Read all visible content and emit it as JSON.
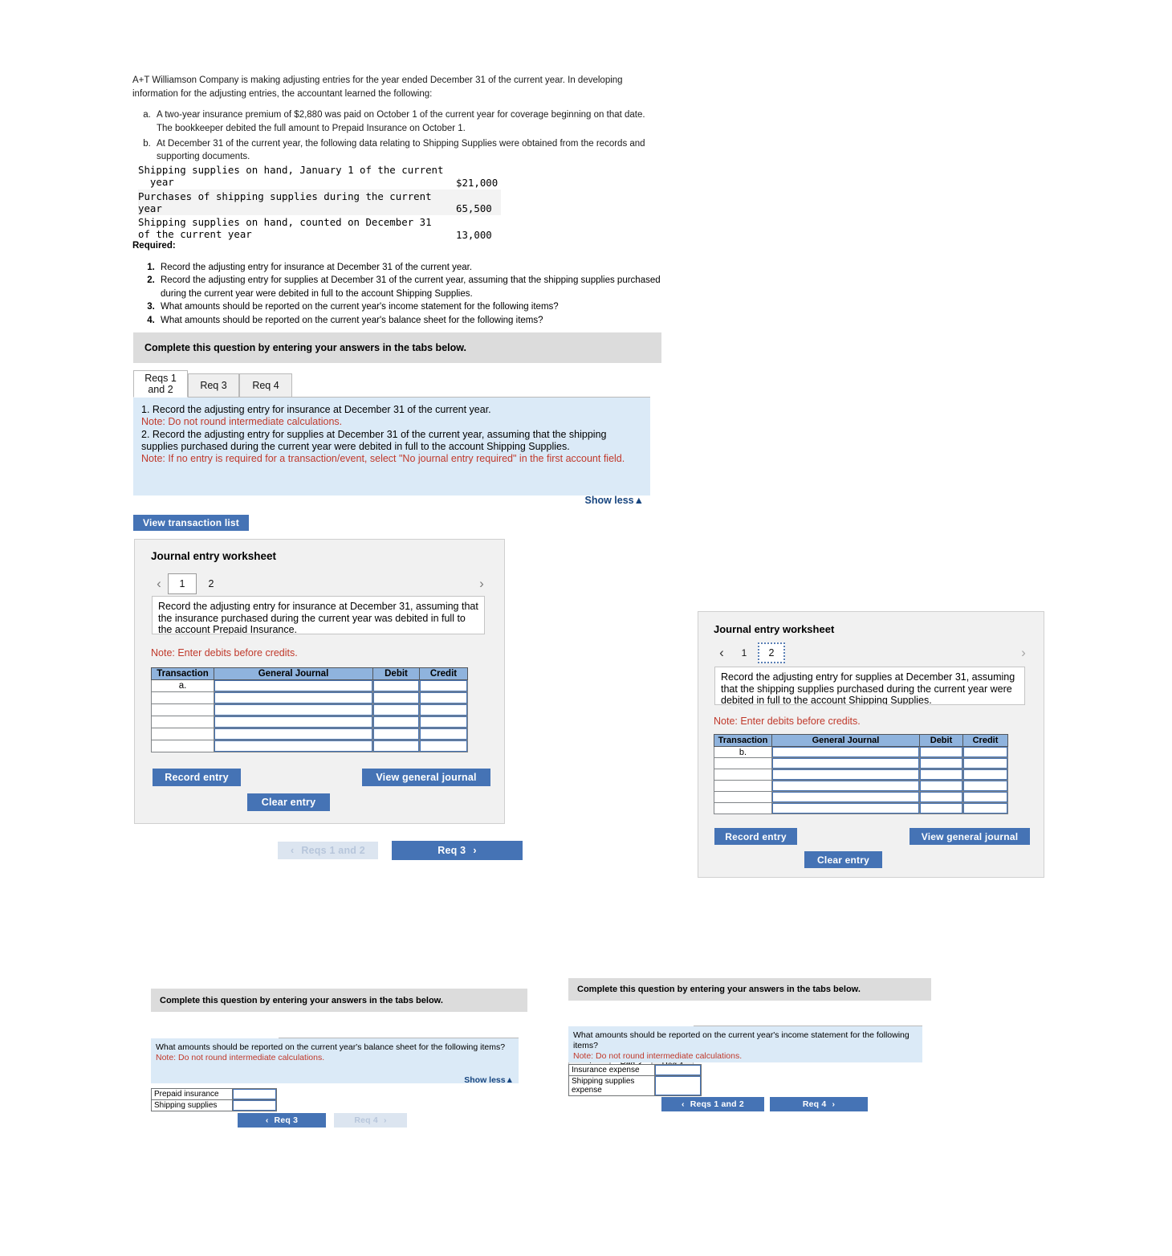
{
  "problem": {
    "intro": "A+T Williamson Company is making adjusting entries for the year ended December 31 of the current year. In developing information for the adjusting entries, the accountant learned the following:",
    "items": [
      "A two-year insurance premium of $2,880 was paid on October 1 of the current year for coverage beginning on that date. The bookkeeper debited the full amount to Prepaid Insurance on October 1.",
      "At December 31 of the current year, the following data relating to Shipping Supplies were obtained from the records and supporting documents."
    ],
    "supplies_table": {
      "rows": [
        {
          "label": "Shipping supplies on hand, January 1 of the current\n  year",
          "value": "$21,000"
        },
        {
          "label": "Purchases of shipping supplies during the current\nyear",
          "value": "65,500"
        },
        {
          "label": "Shipping supplies on hand, counted on December 31\nof the current year",
          "value": "13,000"
        }
      ]
    },
    "required_heading": "Required:",
    "required_items": [
      "Record the adjusting entry for insurance at December 31 of the current year.",
      "Record the adjusting entry for supplies at December 31 of the current year, assuming that the shipping supplies purchased during the current year were debited in full to the account Shipping Supplies.",
      "What amounts should be reported on the current year's income statement for the following items?",
      "What amounts should be reported on the current year's balance sheet for the following items?"
    ]
  },
  "common": {
    "complete_bar": "Complete this question by entering your answers in the tabs below.",
    "tabs": [
      "Reqs 1 and 2",
      "Req 3",
      "Req 4"
    ],
    "tab_lines": [
      [
        "Reqs 1",
        "and 2"
      ],
      [
        "Req 3"
      ],
      [
        "Req 4"
      ]
    ],
    "show_less": "Show less",
    "show_less_caret": "▲",
    "prev_arrow": "‹",
    "next_arrow": "›",
    "accent_blue": "#4573b5",
    "panel_blue": "#dbeaf7",
    "note_red": "#c0392b"
  },
  "panel_reqs12": {
    "instruction_line1": "1. Record the adjusting entry for insurance at December 31 of the current year.",
    "note1": "Note: Do not round intermediate calculations.",
    "instruction_line2": "2. Record the adjusting entry for supplies at December 31 of the current year, assuming that the shipping supplies purchased during the current year were debited in full to the account Shipping Supplies.",
    "note2": "Note: If no entry is required for a transaction/event, select \"No journal entry required\" in the first account field.",
    "view_transaction_list": "View transaction list",
    "worksheet": {
      "title": "Journal entry worksheet",
      "pages": [
        "1",
        "2"
      ],
      "active_page": "1",
      "prompt": "Record the adjusting entry for insurance at December 31, assuming that the insurance purchased during the current year was debited in full to the account Prepaid Insurance.",
      "note": "Note: Enter debits before credits.",
      "columns": [
        "Transaction",
        "General Journal",
        "Debit",
        "Credit"
      ],
      "rows": [
        {
          "txn": "a.",
          "general_journal": "",
          "debit": "",
          "credit": ""
        },
        {
          "txn": "",
          "general_journal": "",
          "debit": "",
          "credit": ""
        },
        {
          "txn": "",
          "general_journal": "",
          "debit": "",
          "credit": ""
        },
        {
          "txn": "",
          "general_journal": "",
          "debit": "",
          "credit": ""
        },
        {
          "txn": "",
          "general_journal": "",
          "debit": "",
          "credit": ""
        },
        {
          "txn": "",
          "general_journal": "",
          "debit": "",
          "credit": ""
        }
      ],
      "record_entry": "Record entry",
      "clear_entry": "Clear entry",
      "view_general_journal": "View general journal"
    },
    "nav_prev": "Reqs 1 and 2",
    "nav_next": "Req 3"
  },
  "panel_worksheet2": {
    "title": "Journal entry worksheet",
    "pages": [
      "1",
      "2"
    ],
    "active_page": "2",
    "prompt": "Record the adjusting entry for supplies at December 31, assuming that the shipping supplies purchased during the current year were debited in full to the account Shipping Supplies.",
    "note": "Note: Enter debits before credits.",
    "columns": [
      "Transaction",
      "General Journal",
      "Debit",
      "Credit"
    ],
    "rows": [
      {
        "txn": "b.",
        "general_journal": "",
        "debit": "",
        "credit": ""
      },
      {
        "txn": "",
        "general_journal": "",
        "debit": "",
        "credit": ""
      },
      {
        "txn": "",
        "general_journal": "",
        "debit": "",
        "credit": ""
      },
      {
        "txn": "",
        "general_journal": "",
        "debit": "",
        "credit": ""
      },
      {
        "txn": "",
        "general_journal": "",
        "debit": "",
        "credit": ""
      },
      {
        "txn": "",
        "general_journal": "",
        "debit": "",
        "credit": ""
      }
    ],
    "record_entry": "Record entry",
    "clear_entry": "Clear entry",
    "view_general_journal": "View general journal"
  },
  "panel_req4": {
    "complete_bar": "Complete this question by entering your answers in the tabs below.",
    "active_tab": "Req 4",
    "question": "What amounts should be reported on the current year's balance sheet for the following items?",
    "note": "Note: Do not round intermediate calculations.",
    "show_less": "Show less",
    "answer_rows": [
      {
        "label": "Prepaid insurance",
        "value": ""
      },
      {
        "label": "Shipping supplies",
        "value": ""
      }
    ],
    "nav_prev": "Req 3",
    "nav_next": "Req 4"
  },
  "panel_req3": {
    "complete_bar": "Complete this question by entering your answers in the tabs below.",
    "active_tab": "Req 3",
    "question": "What amounts should be reported on the current year's income statement for the following items?",
    "note": "Note: Do not round intermediate calculations.",
    "answer_rows": [
      {
        "label": "Insurance expense",
        "value": ""
      },
      {
        "label": "Shipping supplies expense",
        "value": ""
      }
    ],
    "nav_prev": "Reqs 1 and 2",
    "nav_next": "Req 4"
  }
}
